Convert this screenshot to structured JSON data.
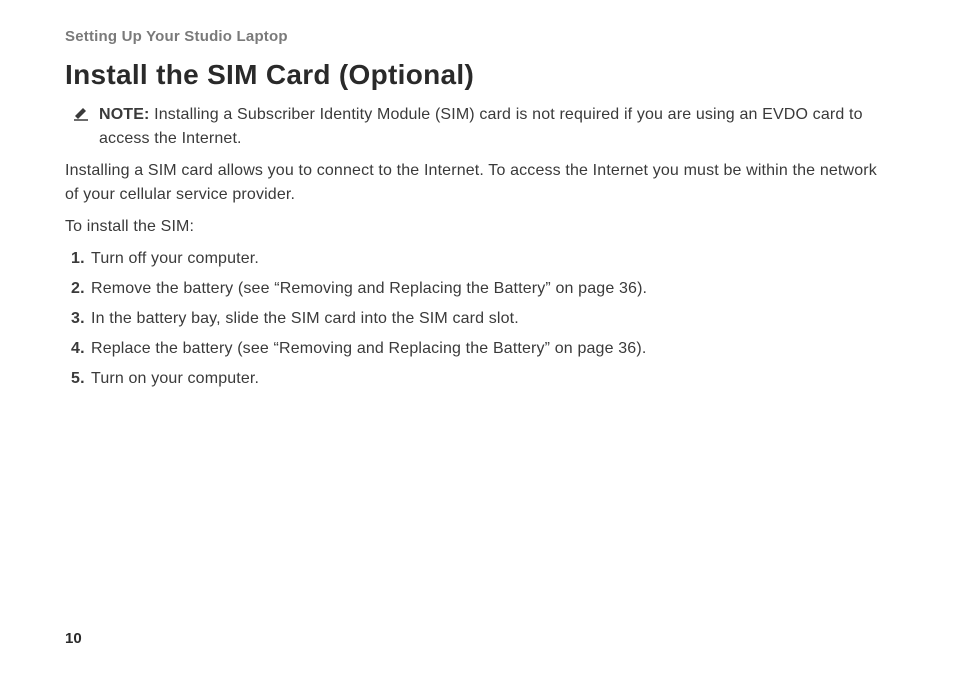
{
  "sectionHeader": "Setting Up Your Studio Laptop",
  "pageTitle": "Install the SIM Card (Optional)",
  "note": {
    "label": "NOTE:",
    "text": " Installing a Subscriber Identity Module (SIM) card is not required if you are using an EVDO card to access the Internet."
  },
  "para1": "Installing a SIM card allows you to connect to the Internet. To access the Internet you must be within the network of your cellular service provider.",
  "para2": "To install the SIM:",
  "steps": [
    "Turn off your computer.",
    "Remove the battery (see “Removing and Replacing the Battery” on page 36).",
    "In the battery bay, slide the SIM card into the SIM card slot.",
    "Replace the battery (see “Removing and Replacing the Battery” on page 36).",
    "Turn on your computer."
  ],
  "pageNumber": "10"
}
